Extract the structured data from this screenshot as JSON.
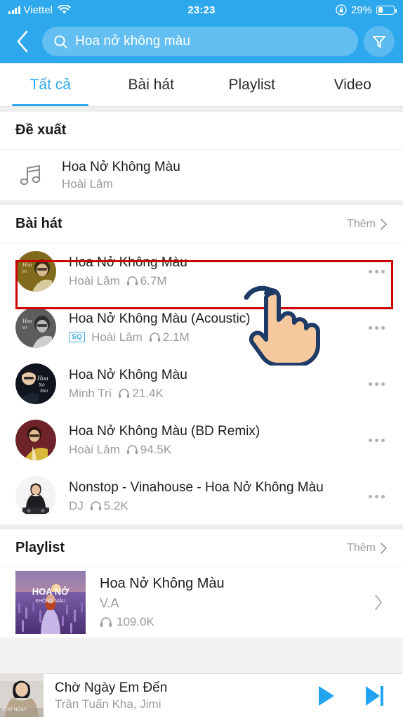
{
  "status_bar": {
    "carrier": "Viettel",
    "signal_icon": "cellular-signal-icon",
    "wifi_icon": "wifi-icon",
    "time": "23:23",
    "rotation_lock_icon": "rotation-lock-icon",
    "battery_percent": "29%",
    "battery_level": 29
  },
  "header": {
    "back_icon": "back-chevron-icon",
    "search_icon": "search-icon",
    "search_value": "Hoa nở không màu",
    "search_placeholder": "Hoa nở không màu",
    "filter_icon": "filter-icon",
    "background_color": "#2da8ec"
  },
  "tabs": {
    "active_index": 0,
    "items": [
      {
        "label": "Tất cả"
      },
      {
        "label": "Bài hát"
      },
      {
        "label": "Playlist"
      },
      {
        "label": "Video"
      }
    ],
    "active_color": "#2da8ec"
  },
  "suggest_section": {
    "title": "Đề xuất",
    "item": {
      "icon": "music-note-icon",
      "title": "Hoa Nở Không Màu",
      "artist": "Hoài Lâm"
    }
  },
  "songs_section": {
    "title": "Bài hát",
    "more_label": "Thêm",
    "more_icon": "chevron-right-icon",
    "items": [
      {
        "title": "Hoa Nở Không Màu",
        "artist": "Hoài Lâm",
        "plays": "6.7M",
        "badge": "",
        "highlighted": true,
        "cover": "gold"
      },
      {
        "title": "Hoa Nở Không Màu (Acoustic)",
        "artist": "Hoài Lâm",
        "plays": "2.1M",
        "badge": "SQ",
        "highlighted": false,
        "cover": "grey"
      },
      {
        "title": "Hoa Nở Không Màu",
        "artist": "Minh Trí",
        "plays": "21.4K",
        "badge": "",
        "highlighted": false,
        "cover": "navy"
      },
      {
        "title": "Hoa Nở Không Màu (BD Remix)",
        "artist": "Hoài Lâm",
        "plays": "94.5K",
        "badge": "",
        "highlighted": false,
        "cover": "maroon"
      },
      {
        "title": "Nonstop - Vinahouse - Hoa Nở Không Màu",
        "artist": "DJ",
        "plays": "5.2K",
        "badge": "",
        "highlighted": false,
        "cover": "white"
      }
    ],
    "menu_icon": "more-options-icon",
    "plays_icon": "headphone-icon"
  },
  "playlist_section": {
    "title": "Playlist",
    "more_label": "Thêm",
    "more_icon": "chevron-right-icon",
    "item": {
      "title": "Hoa Nở Không Màu",
      "artist": "V.A",
      "plays": "109.0K",
      "cover_title_line1": "HOA NỞ",
      "cover_title_line2": "KHÔNG MÀU",
      "chevron_icon": "chevron-right-icon"
    }
  },
  "player_bar": {
    "title": "Chờ Ngày Em Đến",
    "artist": "Trần Tuấn Kha, Jimi",
    "cover_caption": "CHỜ NGÀY",
    "play_icon": "play-icon",
    "next_icon": "skip-next-icon",
    "control_color": "#22a3ef"
  },
  "annotation": {
    "highlight_color": "#cc0000",
    "cursor_icon": "pointing-hand-cursor-icon"
  }
}
